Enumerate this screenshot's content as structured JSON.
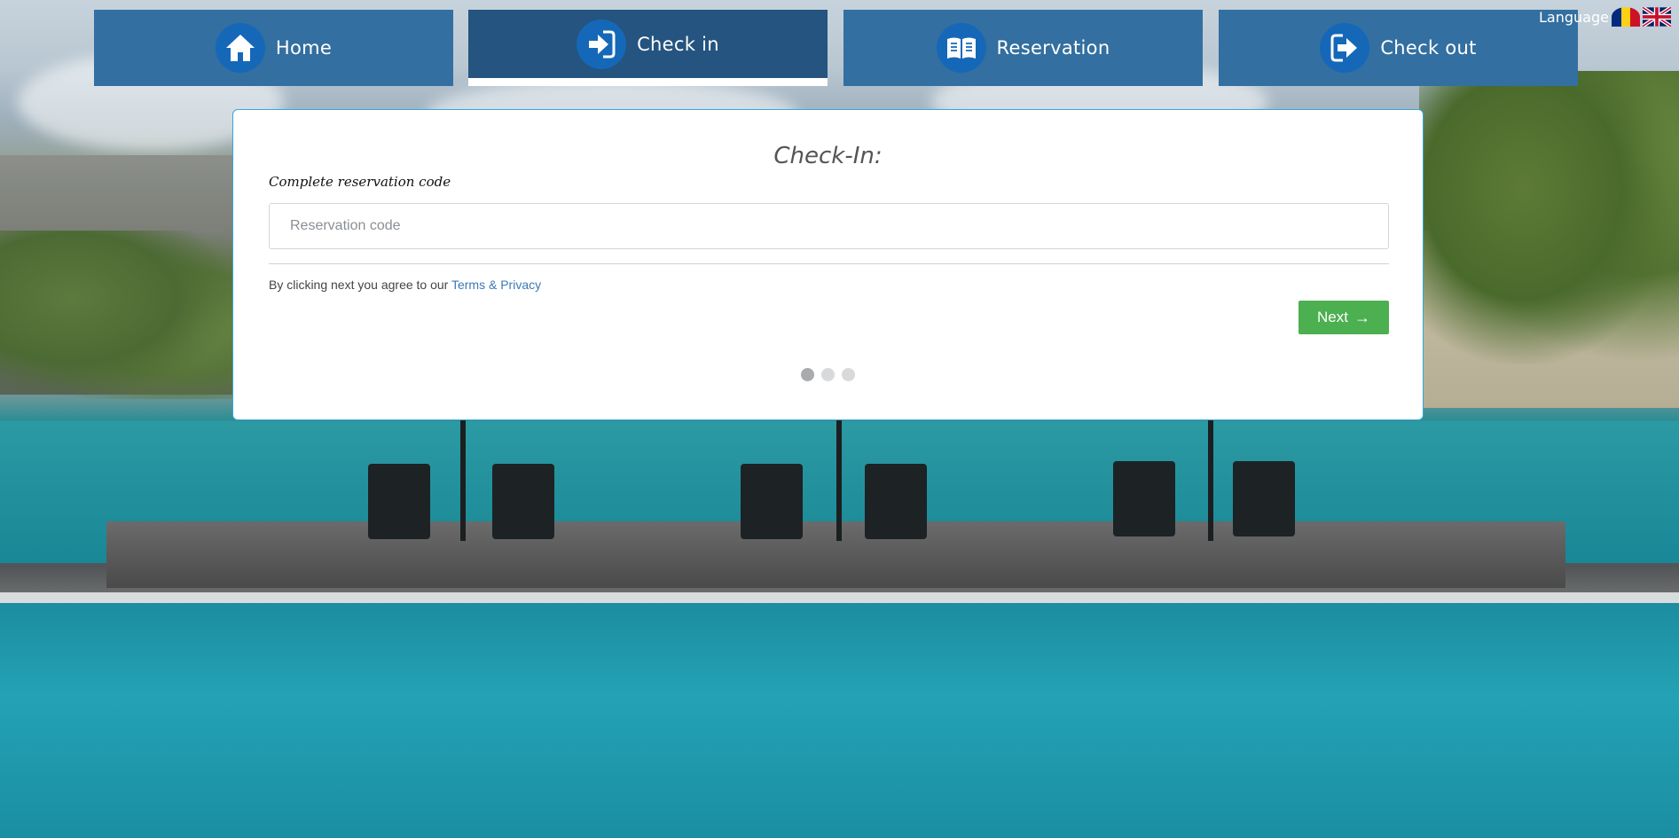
{
  "nav": {
    "tabs": [
      {
        "label": "Home",
        "icon": "home-icon",
        "active": false
      },
      {
        "label": "Check in",
        "icon": "check-in-arrow-icon",
        "active": true
      },
      {
        "label": "Reservation",
        "icon": "open-book-icon",
        "active": false
      },
      {
        "label": "Check out",
        "icon": "check-out-arrow-icon",
        "active": false
      }
    ]
  },
  "language": {
    "label": "Language",
    "flags": [
      "romania-flag-icon",
      "uk-flag-icon"
    ]
  },
  "card": {
    "title": "Check-In:",
    "field_label": "Complete reservation code",
    "input": {
      "placeholder": "Reservation code",
      "value": ""
    },
    "terms_prefix": "By clicking next you agree to our",
    "terms_link": "Terms & Privacy",
    "next_label": "Next",
    "steps": {
      "total": 3,
      "current": 1
    }
  },
  "colors": {
    "tab": "#336fa0",
    "tab_active": "#24547f",
    "icon_circle": "#1568b8",
    "next_button": "#4caf50",
    "link": "#3a79b7",
    "card_border": "#38a5d8"
  }
}
